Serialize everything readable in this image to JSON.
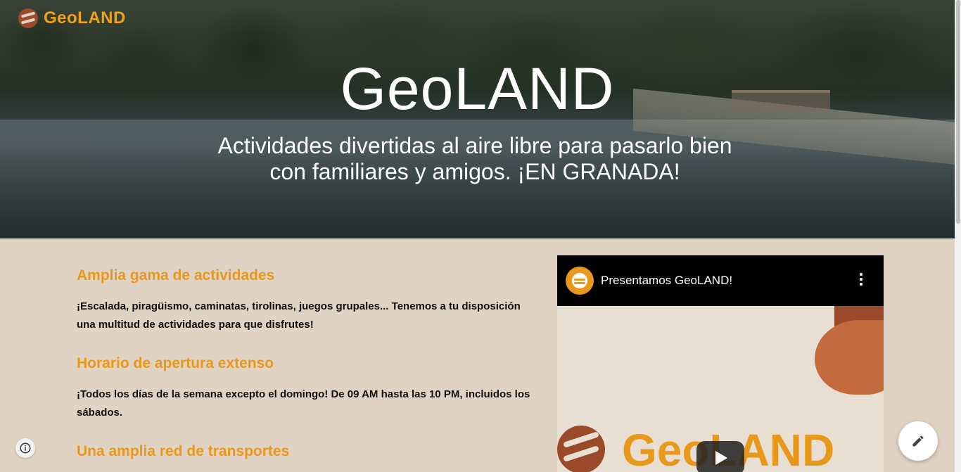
{
  "header": {
    "logo_text": "GeoLAND",
    "logo_icon": "geoland-logo-icon"
  },
  "hero": {
    "title": "GeoLAND",
    "subtitle": "Actividades divertidas al aire libre para pasarlo bien con familiares y amigos. ¡EN GRANADA!"
  },
  "sections": [
    {
      "heading": "Amplia gama de actividades",
      "body": "¡Escalada, piragüismo, caminatas, tirolinas, juegos grupales... Tenemos a tu disposición una multitud de actividades para que disfrutes!"
    },
    {
      "heading": "Horario de apertura extenso",
      "body": "¡Todos los días de la semana excepto el domingo! De 09 AM hasta las 10 PM, incluidos los sábados."
    },
    {
      "heading": "Una amplia red de transportes",
      "body": ""
    }
  ],
  "video": {
    "title": "Presentamos GeoLAND!",
    "thumbnail_logo_text": "GeoLAND",
    "menu_icon": "more-vert-icon",
    "play_icon": "play-icon"
  },
  "floating": {
    "edit_icon": "pencil-icon",
    "info_icon": "info-icon"
  },
  "colors": {
    "accent": "#e8981a",
    "background": "#e1d3c3",
    "brand_dark": "#9a4a2a",
    "brand_mid": "#c36a3f"
  }
}
